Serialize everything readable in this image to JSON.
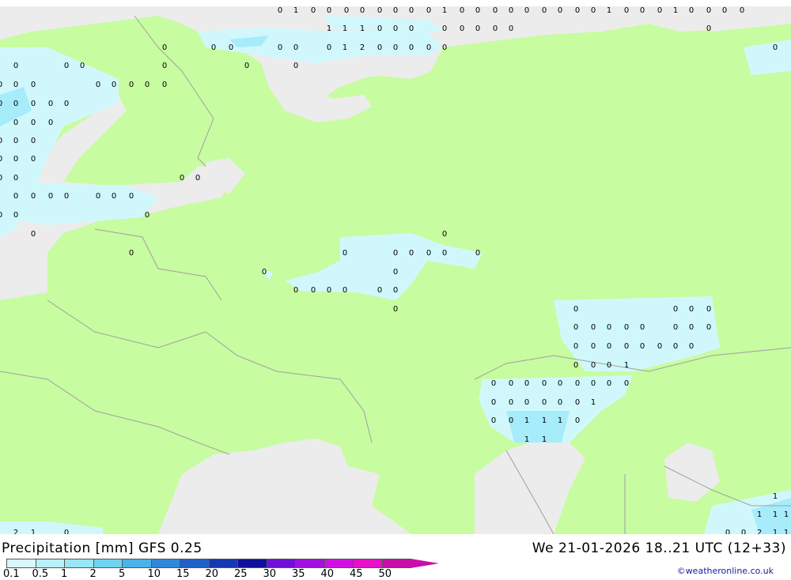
{
  "header": {
    "title": "Precipitation [mm]",
    "model": "GFS 0.25",
    "valid_time": "We 21-01-2026 18..21 UTC (12+33)"
  },
  "credit": "©weatheronline.co.uk",
  "colors": {
    "land_no_precip": "#c8fca0",
    "sea": "#ececec",
    "precip_light": "#d0f8fc",
    "precip_medium": "#a6ecfa",
    "borders": "#a0a0a0"
  },
  "legend": {
    "labels": [
      "0.1",
      "0.5",
      "1",
      "2",
      "5",
      "10",
      "15",
      "20",
      "25",
      "30",
      "35",
      "40",
      "45",
      "50"
    ],
    "colors": [
      "#d8f8fc",
      "#b8f0fa",
      "#98e6f6",
      "#70d4f0",
      "#4ab4e8",
      "#3088dc",
      "#2060c8",
      "#1838b0",
      "#10109a",
      "#7010d8",
      "#a010e0",
      "#d010e0",
      "#e810c8",
      "#c810a8"
    ]
  },
  "precip_values": [
    "0",
    "1",
    "0",
    "0",
    "0",
    "0",
    "0",
    "0",
    "0",
    "0",
    "1",
    "0",
    "0",
    "0",
    "0",
    "0",
    "0",
    "0",
    "0",
    "0",
    "1",
    "0",
    "0",
    "0",
    "1",
    "0",
    "0",
    "0",
    "0",
    "1",
    "1",
    "1",
    "0",
    "0",
    "0",
    "0",
    "0",
    "0",
    "0",
    "0",
    "0",
    "0",
    "0",
    "0",
    "0",
    "0",
    "0",
    "1",
    "2",
    "0",
    "0",
    "0",
    "0",
    "0",
    "0",
    "0",
    "0",
    "0",
    "0",
    "0",
    "0",
    "0",
    "0",
    "0",
    "0",
    "0",
    "0",
    "0",
    "0",
    "0",
    "0",
    "0",
    "0",
    "0",
    "0",
    "0",
    "0",
    "0",
    "0",
    "0",
    "0",
    "0",
    "0",
    "0",
    "0",
    "0",
    "0",
    "0",
    "0",
    "0",
    "0",
    "0",
    "0",
    "0",
    "0",
    "0",
    "0",
    "0",
    "0",
    "0",
    "0",
    "0",
    "0",
    "0",
    "0",
    "0",
    "0",
    "0",
    "0",
    "0",
    "0",
    "0",
    "0",
    "0",
    "0",
    "0",
    "0",
    "0",
    "0",
    "0",
    "0",
    "0",
    "0",
    "0",
    "0",
    "0",
    "0",
    "0",
    "0",
    "0",
    "0",
    "0",
    "0",
    "0",
    "0",
    "0",
    "0",
    "0",
    "1",
    "0",
    "0",
    "0",
    "0",
    "0",
    "0",
    "0",
    "0",
    "0",
    "0",
    "0",
    "0",
    "0",
    "0",
    "0",
    "1",
    "0",
    "0",
    "1",
    "1",
    "1",
    "0",
    "1",
    "1",
    "1",
    "1",
    "1",
    "1",
    "0",
    "0",
    "2",
    "1",
    "1",
    "2",
    "1",
    "0",
    "1",
    "1",
    "1",
    "1",
    "1",
    "1"
  ]
}
